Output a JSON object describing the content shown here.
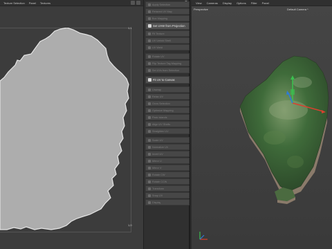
{
  "uv_editor": {
    "menu": [
      "Texture Selection",
      "Panel",
      "Textures"
    ],
    "corner_top": "1,1",
    "corner_bottom": "1,0"
  },
  "commands": {
    "items": [
      "Apply Selection",
      "Relaxed UV Map",
      "Box Mapping",
      "Set UVW from Projection",
      "Fit Texture",
      "UV Unfold Shell",
      "UV Weld",
      "Rotate UV",
      "Flip Texture Tag Mapping",
      "Set UVs from Selection",
      "Fit UV to Canvas",
      "Unwrap",
      "Relax UV",
      "Grow Selection",
      "Optimize Mapping",
      "Pack Islands",
      "Align UV Shells",
      "Straighten UV",
      "Scale UV",
      "Normalize UV",
      "Invert UV",
      "Mirror U",
      "Mirror V",
      "Rotate CW",
      "Rotate CCW",
      "Transform",
      "Snap UV",
      "Display"
    ],
    "highlighted": [
      "Set UVW from Projection",
      "Fit UV to Canvas"
    ]
  },
  "viewport": {
    "menu": [
      "View",
      "Cameras",
      "Display",
      "Options",
      "Filter",
      "Panel"
    ],
    "view_name": "Perspective",
    "camera_name": "Default Camera *"
  },
  "colors": {
    "uv_island": "#adadad",
    "terrain_green": "#3f6b3a",
    "terrain_side": "#8a7a6a",
    "axis_x": "#d8412f",
    "axis_y": "#3bbf4f",
    "axis_z": "#2f7bd8"
  }
}
